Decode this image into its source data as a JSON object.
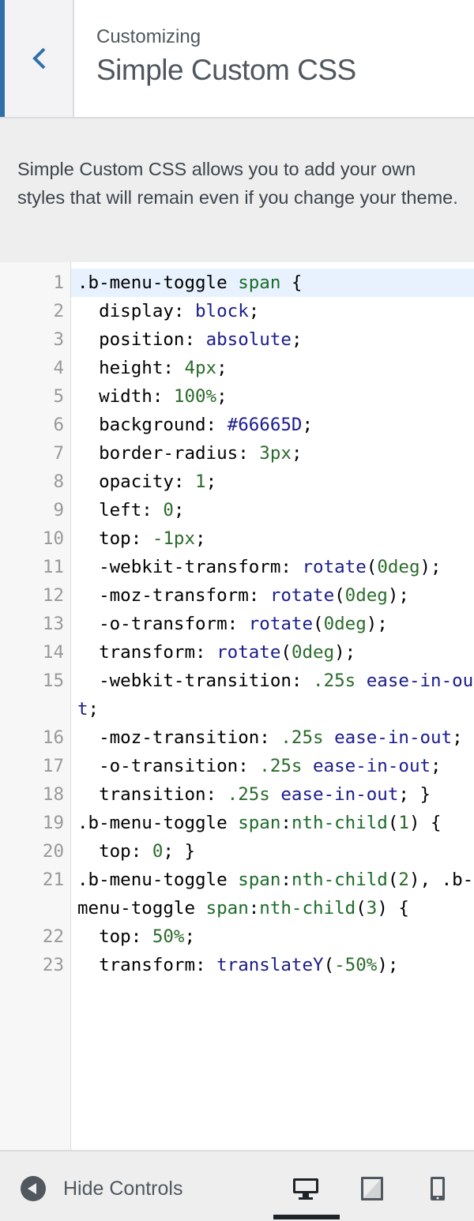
{
  "header": {
    "breadcrumb": "Customizing",
    "title": "Simple Custom CSS"
  },
  "description": "Simple Custom CSS allows you to add your own styles that will remain even if you change your theme.",
  "editor": {
    "lines": [
      {
        "n": "1",
        "tokens": [
          {
            "t": ".b-menu-toggle "
          },
          {
            "t": "span",
            "c": "sel"
          },
          {
            "t": " {"
          }
        ]
      },
      {
        "n": "2",
        "tokens": [
          {
            "t": "  display: "
          },
          {
            "t": "block",
            "c": "kw"
          },
          {
            "t": ";"
          }
        ]
      },
      {
        "n": "3",
        "tokens": [
          {
            "t": "  position: "
          },
          {
            "t": "absolute",
            "c": "kw"
          },
          {
            "t": ";"
          }
        ]
      },
      {
        "n": "4",
        "tokens": [
          {
            "t": "  height: "
          },
          {
            "t": "4px",
            "c": "num"
          },
          {
            "t": ";"
          }
        ]
      },
      {
        "n": "5",
        "tokens": [
          {
            "t": "  width: "
          },
          {
            "t": "100%",
            "c": "num"
          },
          {
            "t": ";"
          }
        ]
      },
      {
        "n": "6",
        "tokens": [
          {
            "t": "  background: "
          },
          {
            "t": "#66665D",
            "c": "kw"
          },
          {
            "t": ";"
          }
        ]
      },
      {
        "n": "7",
        "tokens": [
          {
            "t": "  border-radius: "
          },
          {
            "t": "3px",
            "c": "num"
          },
          {
            "t": ";"
          }
        ]
      },
      {
        "n": "8",
        "tokens": [
          {
            "t": "  opacity: "
          },
          {
            "t": "1",
            "c": "num"
          },
          {
            "t": ";"
          }
        ]
      },
      {
        "n": "9",
        "tokens": [
          {
            "t": "  left: "
          },
          {
            "t": "0",
            "c": "num"
          },
          {
            "t": ";"
          }
        ]
      },
      {
        "n": "10",
        "tokens": [
          {
            "t": "  top: "
          },
          {
            "t": "-1px",
            "c": "num"
          },
          {
            "t": ";"
          }
        ]
      },
      {
        "n": "11",
        "tokens": [
          {
            "t": "  -webkit-transform: "
          },
          {
            "t": "rotate",
            "c": "kw"
          },
          {
            "t": "("
          },
          {
            "t": "0deg",
            "c": "num"
          },
          {
            "t": ");"
          }
        ]
      },
      {
        "n": "12",
        "tokens": [
          {
            "t": "  -moz-transform: "
          },
          {
            "t": "rotate",
            "c": "kw"
          },
          {
            "t": "("
          },
          {
            "t": "0deg",
            "c": "num"
          },
          {
            "t": ");"
          }
        ]
      },
      {
        "n": "13",
        "tokens": [
          {
            "t": "  -o-transform: "
          },
          {
            "t": "rotate",
            "c": "kw"
          },
          {
            "t": "("
          },
          {
            "t": "0deg",
            "c": "num"
          },
          {
            "t": ");"
          }
        ]
      },
      {
        "n": "14",
        "tokens": [
          {
            "t": "  transform: "
          },
          {
            "t": "rotate",
            "c": "kw"
          },
          {
            "t": "("
          },
          {
            "t": "0deg",
            "c": "num"
          },
          {
            "t": ");"
          }
        ]
      },
      {
        "n": "15",
        "tokens": [
          {
            "t": "  -webkit-transition: "
          },
          {
            "t": ".25s",
            "c": "num"
          },
          {
            "t": " "
          },
          {
            "t": "ease-in-out",
            "c": "kw"
          },
          {
            "t": ";"
          }
        ]
      },
      {
        "n": "16",
        "tokens": [
          {
            "t": "  -moz-transition: "
          },
          {
            "t": ".25s",
            "c": "num"
          },
          {
            "t": " "
          },
          {
            "t": "ease-in-out",
            "c": "kw"
          },
          {
            "t": ";"
          }
        ]
      },
      {
        "n": "17",
        "tokens": [
          {
            "t": "  -o-transition: "
          },
          {
            "t": ".25s",
            "c": "num"
          },
          {
            "t": " "
          },
          {
            "t": "ease-in-out",
            "c": "kw"
          },
          {
            "t": ";"
          }
        ]
      },
      {
        "n": "18",
        "tokens": [
          {
            "t": "  transition: "
          },
          {
            "t": ".25s",
            "c": "num"
          },
          {
            "t": " "
          },
          {
            "t": "ease-in-out",
            "c": "kw"
          },
          {
            "t": "; }"
          }
        ]
      },
      {
        "n": "19",
        "tokens": [
          {
            "t": ".b-menu-toggle "
          },
          {
            "t": "span",
            "c": "sel"
          },
          {
            "t": ":"
          },
          {
            "t": "nth-child",
            "c": "sel"
          },
          {
            "t": "("
          },
          {
            "t": "1",
            "c": "num"
          },
          {
            "t": ") {"
          }
        ]
      },
      {
        "n": "20",
        "tokens": [
          {
            "t": "  top: "
          },
          {
            "t": "0",
            "c": "num"
          },
          {
            "t": "; }"
          }
        ]
      },
      {
        "n": "21",
        "tokens": [
          {
            "t": ".b-menu-toggle "
          },
          {
            "t": "span",
            "c": "sel"
          },
          {
            "t": ":"
          },
          {
            "t": "nth-child",
            "c": "sel"
          },
          {
            "t": "("
          },
          {
            "t": "2",
            "c": "num"
          },
          {
            "t": "), .b-menu-toggle "
          },
          {
            "t": "span",
            "c": "sel"
          },
          {
            "t": ":"
          },
          {
            "t": "nth-child",
            "c": "sel"
          },
          {
            "t": "("
          },
          {
            "t": "3",
            "c": "num"
          },
          {
            "t": ") {"
          }
        ]
      },
      {
        "n": "22",
        "tokens": [
          {
            "t": "  top: "
          },
          {
            "t": "50%",
            "c": "num"
          },
          {
            "t": ";"
          }
        ]
      },
      {
        "n": "23",
        "tokens": [
          {
            "t": "  transform: "
          },
          {
            "t": "translateY",
            "c": "kw"
          },
          {
            "t": "("
          },
          {
            "t": "-50%",
            "c": "num"
          },
          {
            "t": ");"
          }
        ]
      }
    ]
  },
  "footer": {
    "hide_controls_label": "Hide Controls",
    "devices": [
      "desktop",
      "tablet",
      "mobile"
    ],
    "active_device": "desktop"
  },
  "colors": {
    "accent": "#2f70a8",
    "keyword": "#1b1b8c",
    "number": "#2a6a2a"
  }
}
